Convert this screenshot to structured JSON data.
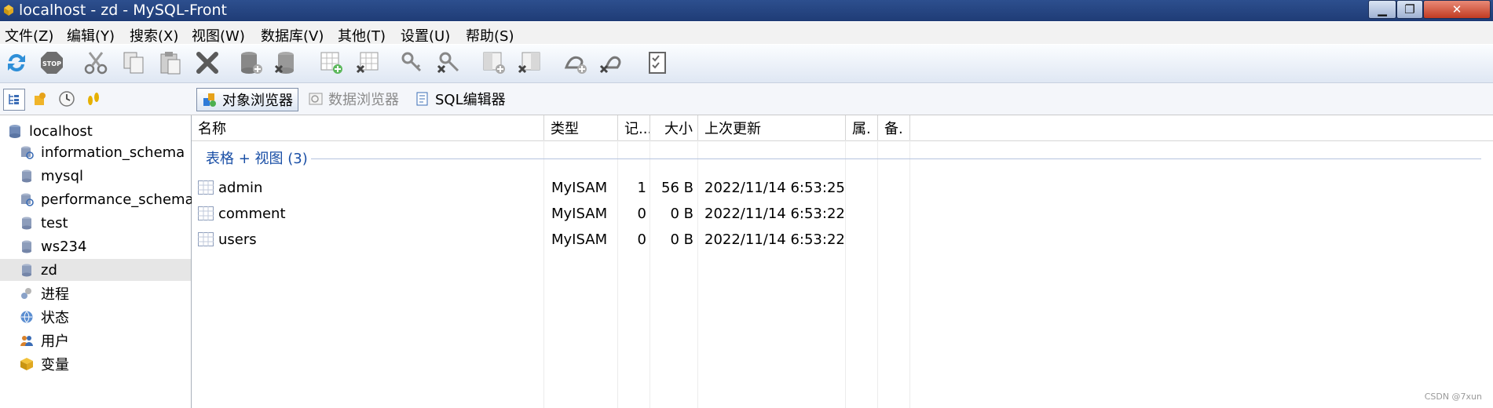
{
  "window": {
    "title": "localhost - zd - MySQL-Front"
  },
  "menu": [
    "文件(Z)",
    "编辑(Y)",
    "搜索(X)",
    "视图(W)",
    "数据库(V)",
    "其他(T)",
    "设置(U)",
    "帮助(S)"
  ],
  "toolbar_icons": [
    "refresh-icon",
    "stop-icon",
    "cut-icon",
    "copy-icon",
    "paste-icon",
    "delete-icon",
    "new-database-icon",
    "drop-database-icon",
    "new-table-icon",
    "drop-table-icon",
    "new-key-icon",
    "drop-key-icon",
    "new-field-icon",
    "drop-field-icon",
    "new-foreign-key-icon",
    "drop-foreign-key-icon",
    "properties-icon"
  ],
  "view_tabs": {
    "object": "对象浏览器",
    "data": "数据浏览器",
    "sql": "SQL编辑器"
  },
  "tree": {
    "root": "localhost",
    "databases": [
      "information_schema",
      "mysql",
      "performance_schema",
      "test",
      "ws234",
      "zd"
    ],
    "selected": "zd",
    "extras": [
      "进程",
      "状态",
      "用户",
      "变量"
    ]
  },
  "columns": {
    "name": "名称",
    "type": "类型",
    "records": "记...",
    "size": "大小",
    "updated": "上次更新",
    "attrs": "属.",
    "comment": "备."
  },
  "group_label": "表格 + 视图 (3)",
  "rows": [
    {
      "name": "admin",
      "type": "MyISAM",
      "records": "1",
      "size": "56 B",
      "updated": "2022/11/14 6:53:25"
    },
    {
      "name": "comment",
      "type": "MyISAM",
      "records": "0",
      "size": "0 B",
      "updated": "2022/11/14 6:53:22"
    },
    {
      "name": "users",
      "type": "MyISAM",
      "records": "0",
      "size": "0 B",
      "updated": "2022/11/14 6:53:22"
    }
  ],
  "watermark": "CSDN @7xun"
}
